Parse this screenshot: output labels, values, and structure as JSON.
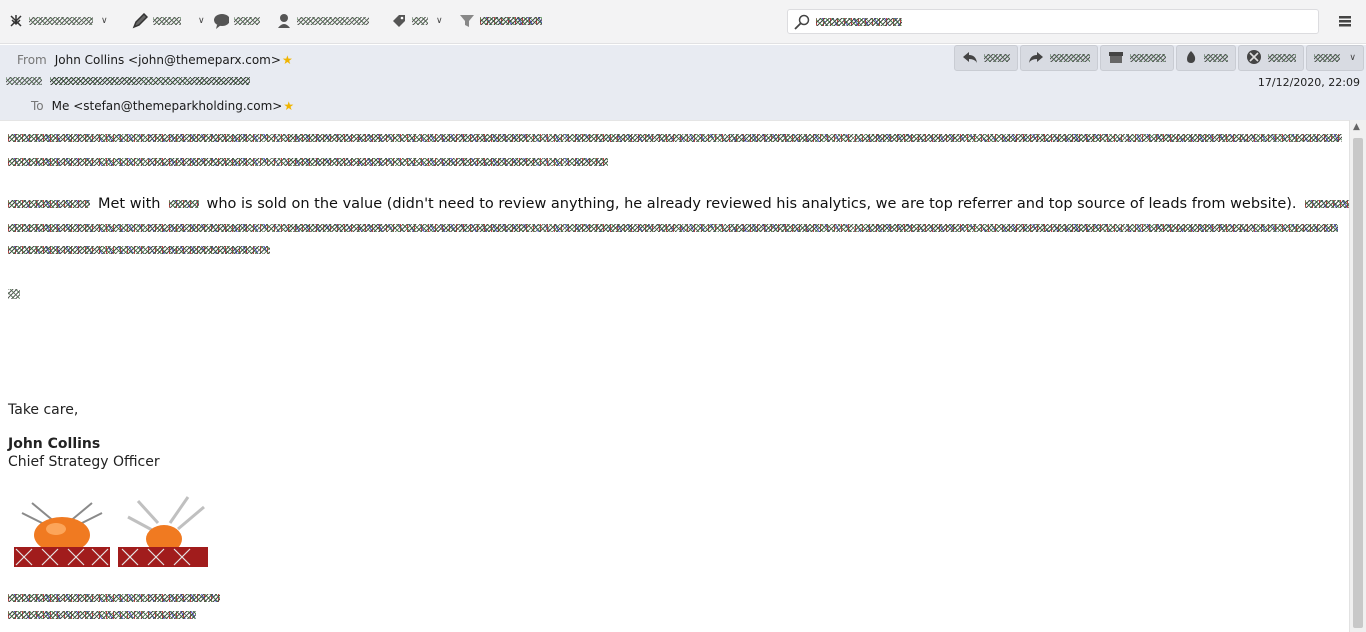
{
  "header": {
    "from_label": "From",
    "from_value": "John Collins <john@themeparx.com>",
    "to_label": "To",
    "to_value": "Me <stefan@themeparkholding.com>",
    "date": "17/12/2020, 22:09"
  },
  "body": {
    "main_text": "Met with",
    "main_text_2": "who is sold on the value (didn't need to review anything, he already reviewed his analytics, we are top referrer and top source of leads from website).",
    "signoff": "Take care,",
    "sig_name": "John Collins",
    "sig_title": "Chief Strategy Officer"
  },
  "icons": {
    "star": "★",
    "scroll_up": "▲",
    "chevron": "∨"
  },
  "colors": {
    "header_bg": "#e8ebf2",
    "toolbar_bg": "#f3f3f4",
    "star": "#f0b400",
    "logo_orange": "#f07a21",
    "logo_red": "#a11c1c"
  }
}
